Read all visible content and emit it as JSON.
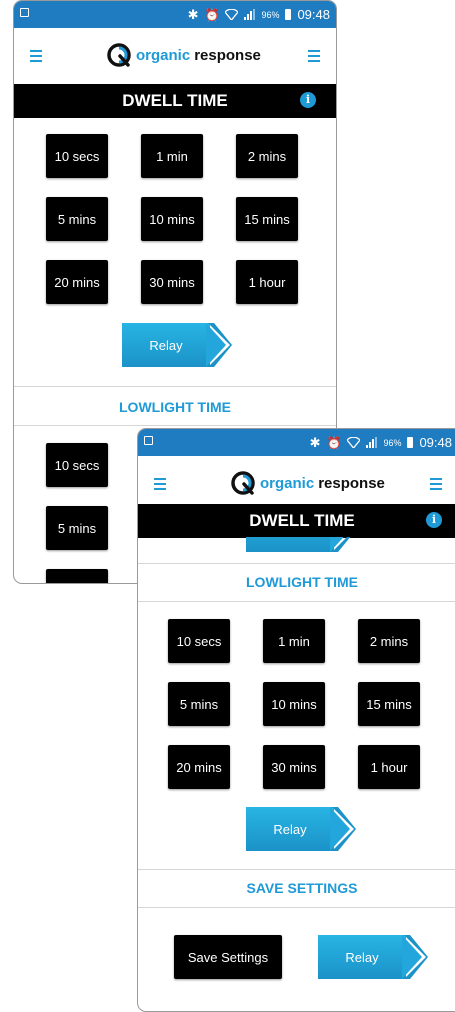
{
  "status": {
    "percent": "96%",
    "time": "09:48"
  },
  "app": {
    "logo_word1": "organic",
    "logo_word2": "response"
  },
  "screen1": {
    "title": "DWELL TIME",
    "dwell_options": [
      "10 secs",
      "1 min",
      "2 mins",
      "5 mins",
      "10 mins",
      "15 mins",
      "20 mins",
      "30 mins",
      "1 hour"
    ],
    "relay_label": "Relay",
    "lowlight_title": "LOWLIGHT TIME",
    "lowlight_partial": [
      "10 secs",
      "5 mins"
    ]
  },
  "screen2": {
    "title": "DWELL TIME",
    "lowlight_title": "LOWLIGHT TIME",
    "lowlight_options": [
      "10 secs",
      "1 min",
      "2 mins",
      "5 mins",
      "10 mins",
      "15 mins",
      "20 mins",
      "30 mins",
      "1 hour"
    ],
    "relay_label": "Relay",
    "save_title": "SAVE SETTINGS",
    "save_button": "Save Settings",
    "save_relay_label": "Relay"
  },
  "colors": {
    "accent": "#1f9ad6",
    "statusbar": "#1f7cc0",
    "button": "#000000"
  },
  "icons": [
    "image-icon",
    "bluetooth-icon",
    "alarm-icon",
    "wifi-icon",
    "signal-icon",
    "battery-icon",
    "menu-icon",
    "logo-icon",
    "info-icon",
    "chevron-right-icon"
  ]
}
